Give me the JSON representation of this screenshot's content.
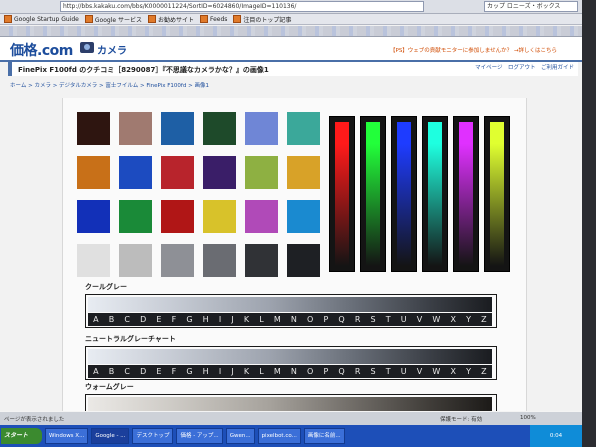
{
  "browser": {
    "address": "http://bbs.kakaku.com/bbs/K0000011224/SortID=6024860/ImageID=110136/",
    "search_placeholder": "カップ ロニーズ・ボックス",
    "bookmarks": [
      "Google Startup Guide",
      "Google サービス",
      "お勧めサイト",
      "Feeds",
      "注目のトップ記事"
    ]
  },
  "site": {
    "logo": "価格.com",
    "section": "カメラ",
    "header_notice": "【PS】ウェブの貢献モニターに参加しませんか？ →詳しくはこちら",
    "thread_title": "FinePix F100fd のクチコミ［8290087］『不思議なカメラかな？』の画像1",
    "thread_links": "マイページ　ログアウト　ご利用ガイド",
    "breadcrumb": "ホーム > カメラ > デジタルカメラ > 富士フイルム > FinePix F100fd > 画像1"
  },
  "chart": {
    "swatch_colors": [
      [
        "#2e1510",
        "#a07a70",
        "#1e5fa5",
        "#1e4a2a",
        "#6f86d6",
        "#3ba89a"
      ],
      [
        "#c87018",
        "#1c4bc0",
        "#b8242c",
        "#3a1e68",
        "#8eb042",
        "#d8a228"
      ],
      [
        "#1230b8",
        "#1a8a38",
        "#b01616",
        "#d8c22a",
        "#b04ab8",
        "#1a8ad0"
      ],
      [
        "#e0e0e0",
        "#bcbcbc",
        "#8e9096",
        "#6a6c72",
        "#303236",
        "#1e2024"
      ]
    ],
    "bar_colors": [
      "#ff1a1a",
      "#22ff3a",
      "#1e3cff",
      "#1effe0",
      "#e030ff",
      "#e0ff30"
    ],
    "strips": [
      {
        "label": "クールグレー",
        "warm": false
      },
      {
        "label": "ニュートラルグレーチャート",
        "warm": false
      },
      {
        "label": "ウォームグレー",
        "warm": true
      }
    ],
    "letters": [
      "A",
      "B",
      "C",
      "D",
      "E",
      "F",
      "G",
      "H",
      "I",
      "J",
      "K",
      "L",
      "M",
      "N",
      "O",
      "P",
      "Q",
      "R",
      "S",
      "T",
      "U",
      "V",
      "W",
      "X",
      "Y",
      "Z"
    ]
  },
  "status": {
    "left": "ページが表示されました",
    "protection": "保護モード: 有効",
    "zoom": "100%"
  },
  "taskbar": {
    "start": "スタート",
    "buttons": [
      "Windows X...",
      "Google - ...",
      "デスクトップ",
      "価格 - アップ...",
      "Gwen...",
      "pixelbot.co...",
      "画像に名前..."
    ],
    "clock": "0:04"
  }
}
